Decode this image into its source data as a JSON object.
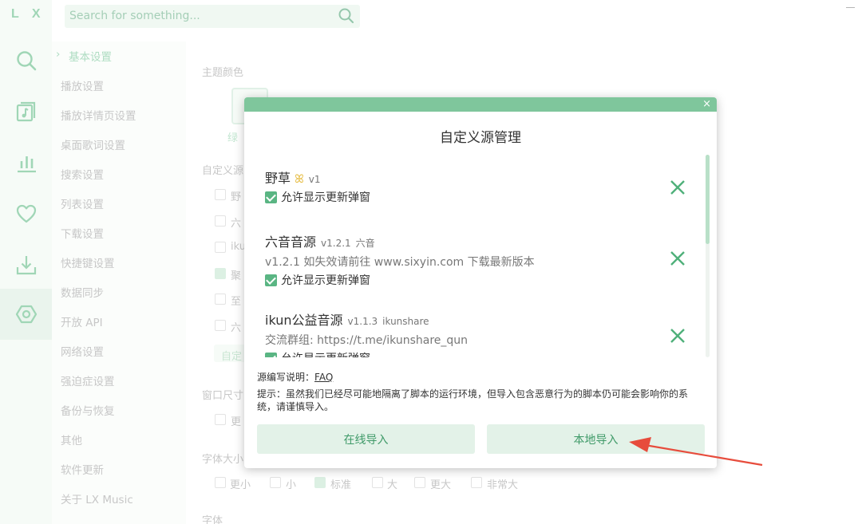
{
  "app": {
    "logo": "L X"
  },
  "search": {
    "placeholder": "Search for something..."
  },
  "settings_nav": {
    "items": [
      "基本设置",
      "播放设置",
      "播放详情页设置",
      "桌面歌词设置",
      "搜索设置",
      "列表设置",
      "下载设置",
      "快捷键设置",
      "数据同步",
      "开放 API",
      "网络设置",
      "强迫症设置",
      "备份与恢复",
      "其他",
      "软件更新",
      "关于 LX Music"
    ]
  },
  "settings_content": {
    "theme_label": "主题颜色",
    "theme_name": "绿",
    "custom_source_label": "自定义源",
    "source_rows": [
      "野",
      "六",
      "iku",
      "聚",
      "至",
      "六"
    ],
    "add_button": "自定",
    "window_size_label": "窗口尺寸",
    "window_size_option": "更",
    "font_size_label": "字体大小",
    "font_size_options": [
      "更小",
      "小",
      "标准",
      "大",
      "更大",
      "非常大"
    ],
    "font_label": "字体"
  },
  "dialog": {
    "title": "自定义源管理",
    "close": "×",
    "sources": [
      {
        "name": "野草",
        "version": "v1",
        "author": "",
        "desc": "",
        "allow_update_popup": "允许显示更新弹窗"
      },
      {
        "name": "六音音源",
        "version": "v1.2.1",
        "author": "六音",
        "desc": "v1.2.1 如失效请前往 www.sixyin.com 下载最新版本",
        "allow_update_popup": "允许显示更新弹窗"
      },
      {
        "name": "ikun公益音源",
        "version": "v1.1.3",
        "author": "ikunshare",
        "desc": "交流群组: https://t.me/ikunshare_qun",
        "allow_update_popup": "允许显示更新弹窗"
      }
    ],
    "doc_label": "源编写说明：",
    "doc_link": "FAQ",
    "tip": "提示：虽然我们已经尽可能地隔离了脚本的运行环境，但导入包含恶意行为的脚本仍可能会影响你的系统，请谨慎导入。",
    "online_import": "在线导入",
    "local_import": "本地导入"
  },
  "colors": {
    "accent": "#5ab583",
    "header": "#7fc69c",
    "button_bg": "#e3f2e8",
    "arrow": "#e74c3c"
  }
}
